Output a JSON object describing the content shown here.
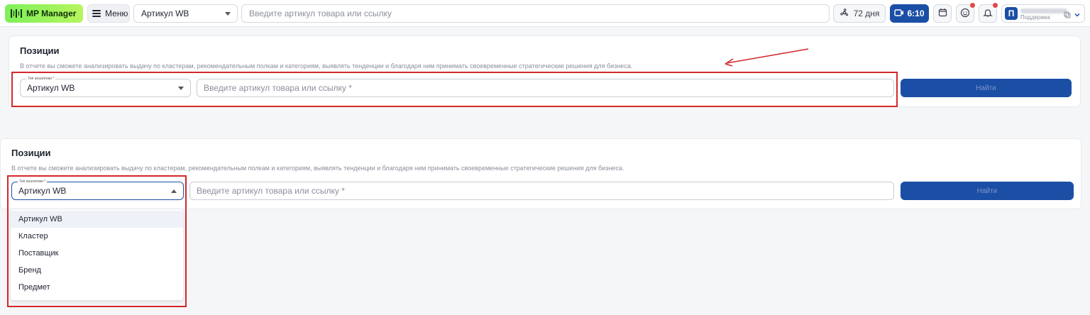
{
  "topbar": {
    "logo_text": "MP Manager",
    "menu_label": "Меню",
    "type_select_value": "Артикул WB",
    "search_placeholder": "Введите артикул товара или ссылку",
    "days_label": "72 дня",
    "timer_label": "6:10",
    "avatar_letter": "П",
    "support_label": "Поддержка"
  },
  "colors": {
    "brand_green": "#7df05a",
    "primary_blue": "#1b4fa6",
    "highlight_red": "#d3282c"
  },
  "card_top": {
    "title": "Позиции",
    "description": "В отчете вы сможете анализировать выдачу по кластерам, рекомендательным полкам и категориям, выявлять тенденции и благодаря ним принимать своевременные стратегические решения для бизнеса.",
    "type_field_label": "Тип аналитики *",
    "type_field_value": "Артикул WB",
    "search_placeholder": "Введите артикул товара или ссылку *",
    "find_button": "Найти"
  },
  "card_bottom": {
    "title": "Позиции",
    "description": "В отчете вы сможете анализировать выдачу по кластерам, рекомендательным полкам и категориям, выявлять тенденции и благодаря ним принимать своевременные стратегические решения для бизнеса.",
    "type_field_label": "Тип аналитики *",
    "type_field_value": "Артикул WB",
    "search_placeholder": "Введите артикул товара или ссылку *",
    "find_button": "Найти",
    "dropdown_options": [
      "Артикул WB",
      "Кластер",
      "Поставщик",
      "Бренд",
      "Предмет"
    ]
  }
}
